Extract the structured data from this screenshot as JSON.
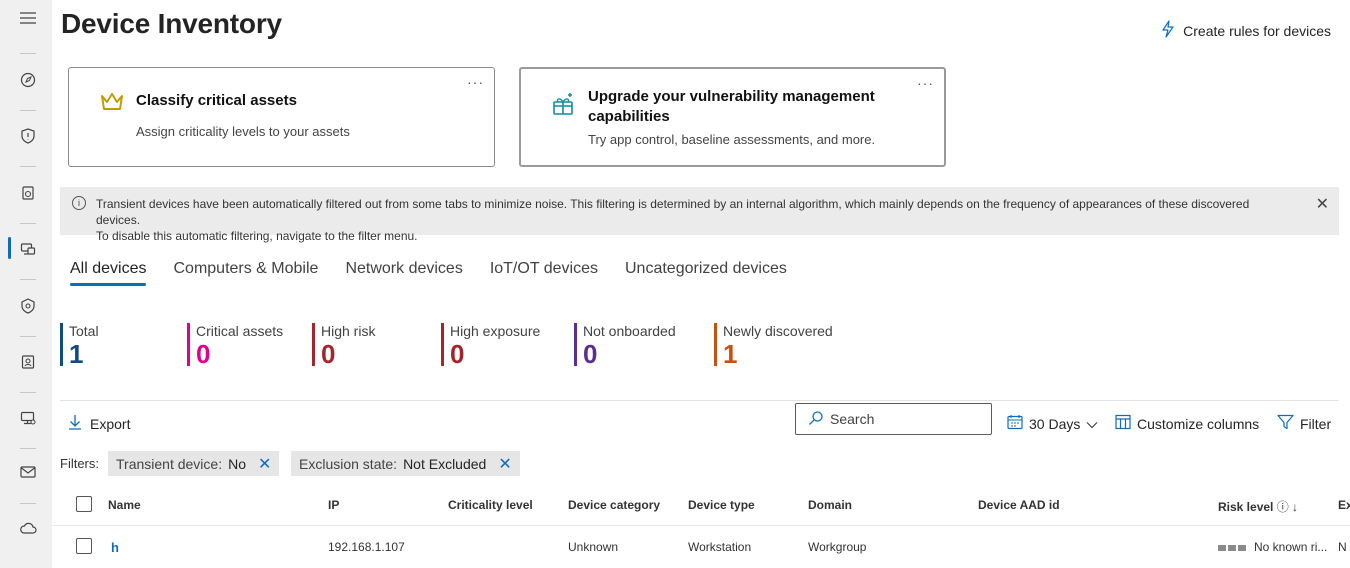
{
  "page": {
    "title": "Device Inventory",
    "create_rules_label": "Create rules for devices"
  },
  "cards": [
    {
      "title": "Classify critical assets",
      "subtitle": "Assign criticality levels to your assets",
      "more": "···"
    },
    {
      "title": "Upgrade your vulnerability management capabilities",
      "subtitle": "Try app control, baseline assessments, and more.",
      "more": "···"
    }
  ],
  "banner": {
    "line1": "Transient devices have been automatically filtered out from some tabs to minimize noise. This filtering is determined by an internal algorithm, which mainly depends on the frequency of appearances of these discovered devices.",
    "line2": "To disable this automatic filtering, navigate to the filter menu."
  },
  "tabs": [
    "All devices",
    "Computers & Mobile",
    "Network devices",
    "IoT/OT devices",
    "Uncategorized devices"
  ],
  "stats": [
    {
      "label": "Total",
      "value": "1",
      "color": "#0f4c81"
    },
    {
      "label": "Critical assets",
      "value": "0",
      "color": "#e3008c"
    },
    {
      "label": "High risk",
      "value": "0",
      "color": "#a4262c"
    },
    {
      "label": "High exposure",
      "value": "0",
      "color": "#a4262c"
    },
    {
      "label": "Not onboarded",
      "value": "0",
      "color": "#5c2e91"
    },
    {
      "label": "Newly discovered",
      "value": "1",
      "color": "#ca5010"
    }
  ],
  "toolbar": {
    "export_label": "Export",
    "search_placeholder": "Search",
    "days_label": "30 Days",
    "customize_label": "Customize columns",
    "filter_label": "Filter"
  },
  "filters": {
    "label": "Filters:",
    "chips": [
      {
        "key": "Transient device:",
        "value": "No"
      },
      {
        "key": "Exclusion state:",
        "value": "Not Excluded"
      }
    ]
  },
  "table": {
    "columns": [
      "Name",
      "IP",
      "Criticality level",
      "Device category",
      "Device type",
      "Domain",
      "Device AAD id",
      "Risk level",
      "Ex"
    ],
    "risk_sort_icon": "ⓘ ↓",
    "rows": [
      {
        "name": "h",
        "ip": "192.168.1.107",
        "criticality": "",
        "category": "Unknown",
        "type": "Workstation",
        "domain": "Workgroup",
        "aad_id": "",
        "risk": "No known ri...",
        "ex": "N"
      }
    ]
  }
}
